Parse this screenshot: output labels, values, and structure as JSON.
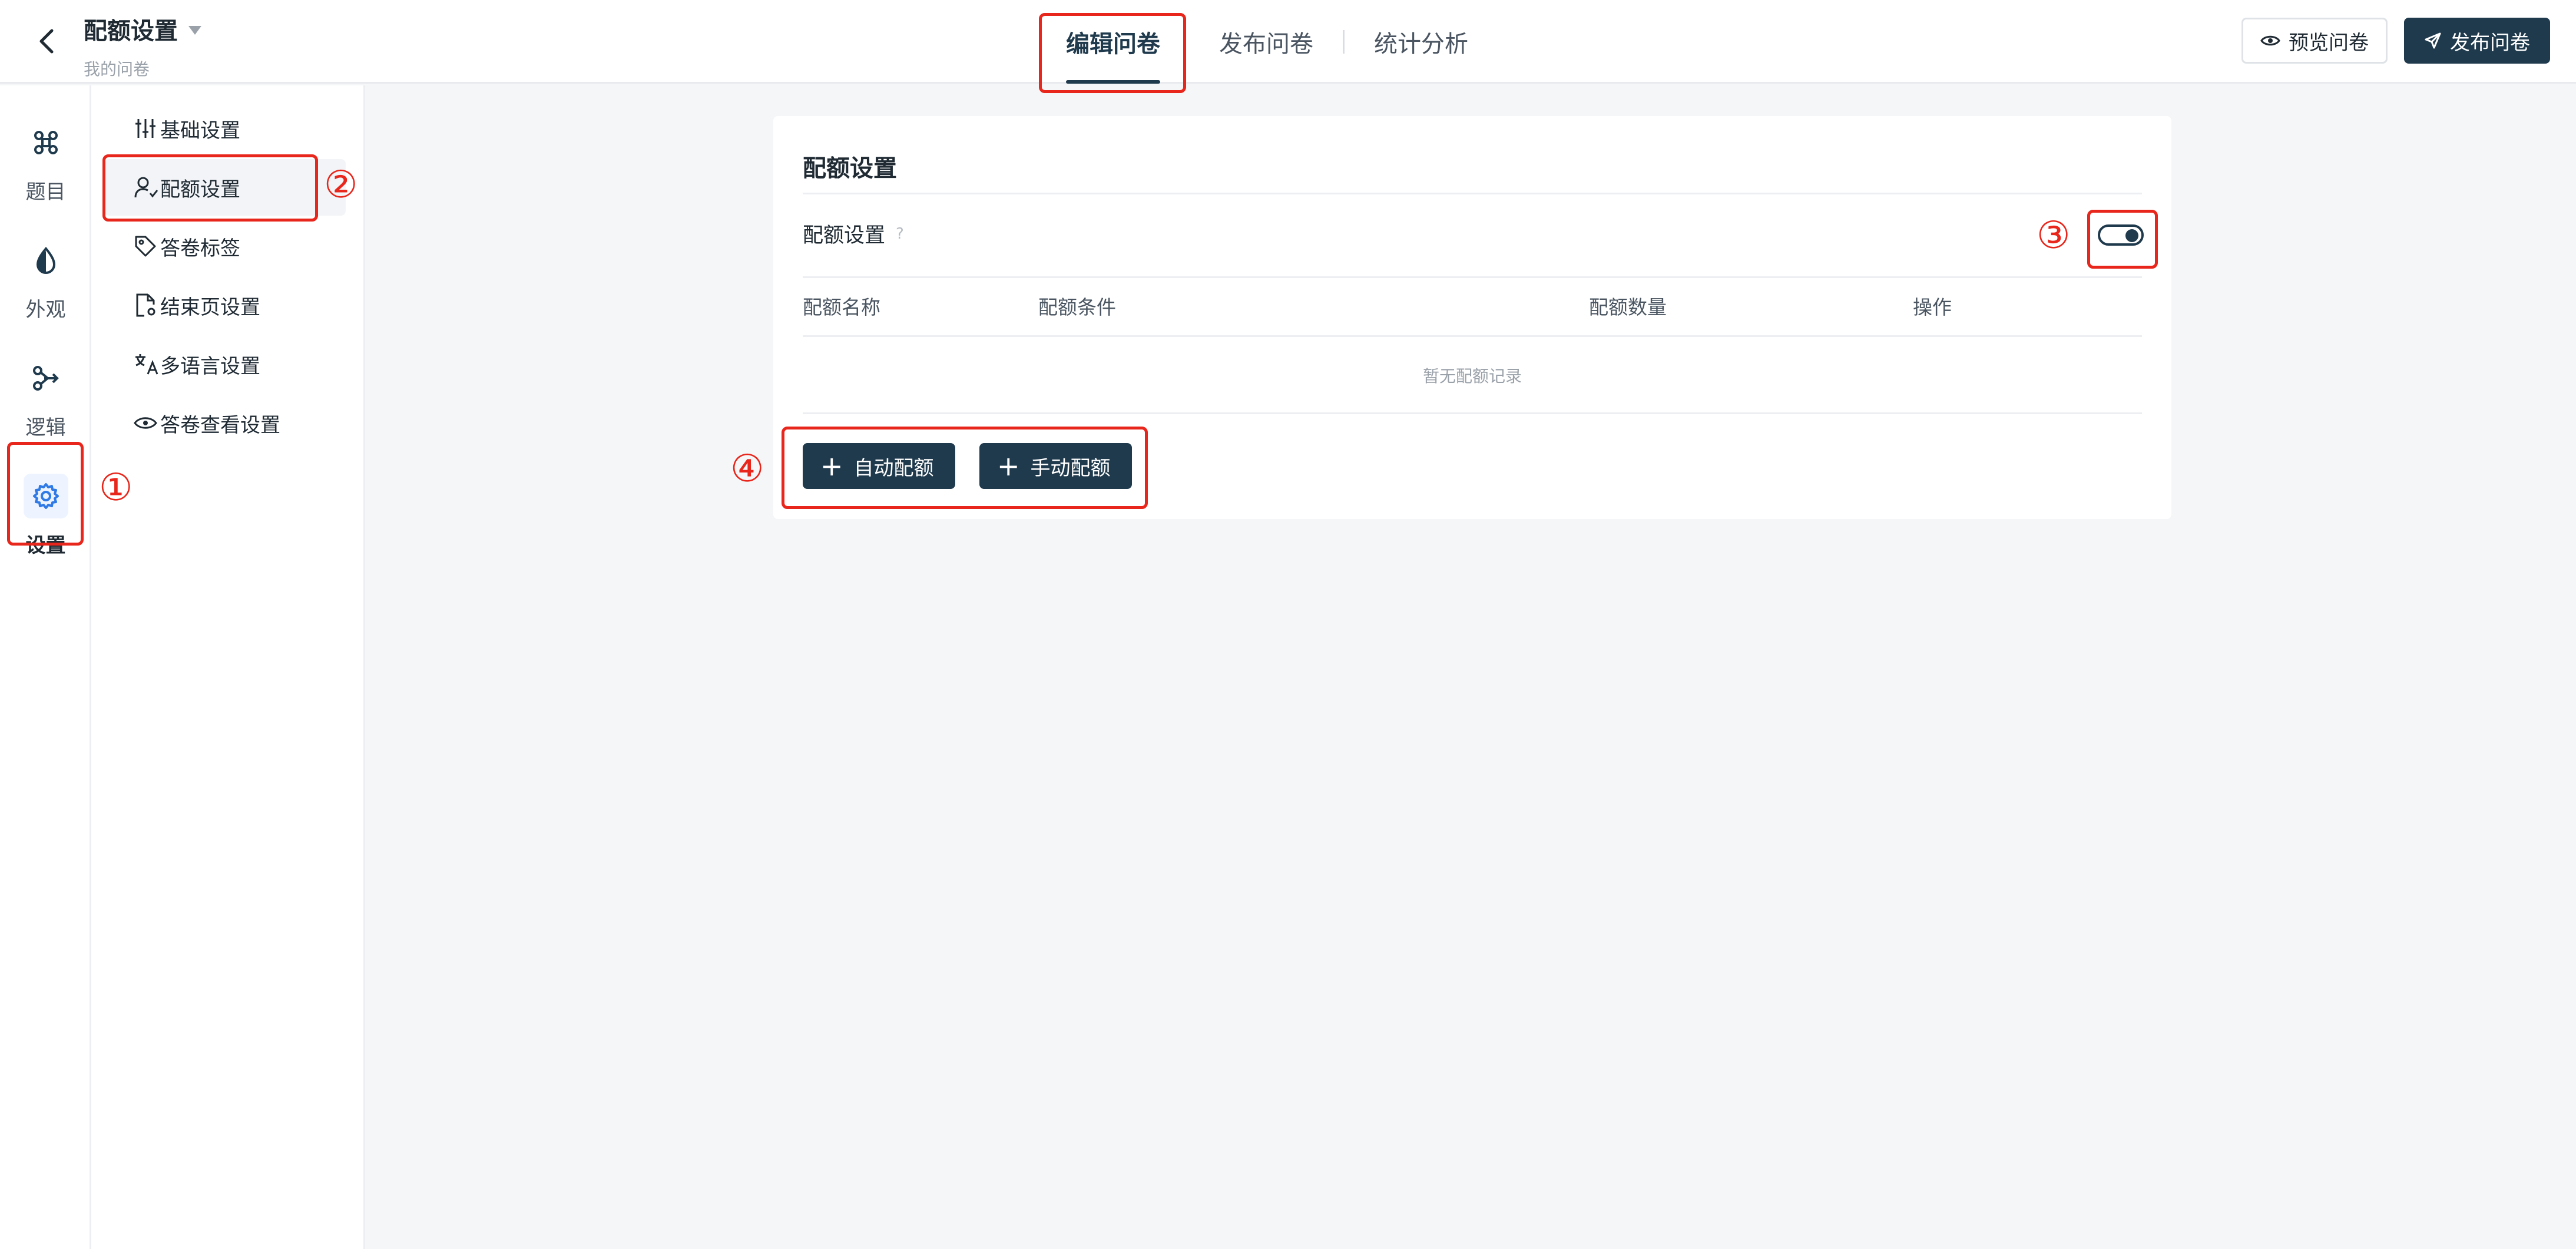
{
  "header": {
    "title": "配额设置",
    "subtitle": "我的问卷",
    "tabs": [
      {
        "label": "编辑问卷",
        "active": true
      },
      {
        "label": "发布问卷",
        "active": false
      },
      {
        "label": "统计分析",
        "active": false
      }
    ],
    "preview_label": "预览问卷",
    "publish_label": "发布问卷"
  },
  "rail": {
    "items": [
      {
        "label": "题目",
        "icon": "command-icon"
      },
      {
        "label": "外观",
        "icon": "drop-icon"
      },
      {
        "label": "逻辑",
        "icon": "branch-icon"
      },
      {
        "label": "设置",
        "icon": "gear-icon",
        "active": true
      }
    ]
  },
  "menu": {
    "items": [
      {
        "label": "基础设置",
        "icon": "sliders-icon"
      },
      {
        "label": "配额设置",
        "icon": "user-quota-icon",
        "active": true
      },
      {
        "label": "答卷标签",
        "icon": "tag-icon"
      },
      {
        "label": "结束页设置",
        "icon": "file-settings-icon"
      },
      {
        "label": "多语言设置",
        "icon": "translate-icon"
      },
      {
        "label": "答卷查看设置",
        "icon": "eye-icon"
      }
    ]
  },
  "card": {
    "title": "配额设置",
    "toggle_label": "配额设置",
    "toggle_on": true,
    "columns": [
      "配额名称",
      "配额条件",
      "配额数量",
      "操作"
    ],
    "empty_text": "暂无配额记录",
    "auto_button": "自动配额",
    "manual_button": "手动配额"
  },
  "annotations": {
    "n1": "①",
    "n2": "②",
    "n3": "③",
    "n4": "④"
  },
  "colors": {
    "primary": "#1f3a4d",
    "annotation": "#e8261b",
    "accent_blue": "#2f7ae5"
  }
}
